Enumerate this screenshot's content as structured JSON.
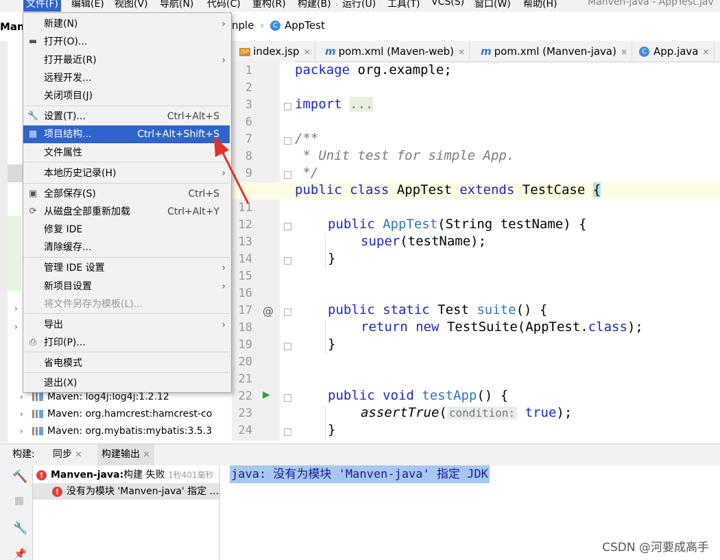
{
  "window": {
    "title": "Manven-java - AppTest.jav",
    "project_name": "Man"
  },
  "menubar": {
    "items": [
      "文件(F)",
      "编辑(E)",
      "视图(V)",
      "导航(N)",
      "代码(C)",
      "重构(R)",
      "构建(B)",
      "运行(U)",
      "工具(T)",
      "VCS(S)",
      "窗口(W)",
      "帮助(H)"
    ]
  },
  "breadcrumb": {
    "prefix": "nple",
    "current": "AppTest"
  },
  "tabs": [
    {
      "label": "index.jsp",
      "icon": "jsp-file-icon"
    },
    {
      "label": "pom.xml (Maven-web)",
      "icon": "maven-icon"
    },
    {
      "label": "pom.xml (Manven-java)",
      "icon": "maven-icon"
    },
    {
      "label": "App.java",
      "icon": "class-icon"
    }
  ],
  "file_menu": {
    "items": [
      {
        "label": "新建(N)",
        "shortcut": "",
        "submenu": true,
        "icon": ""
      },
      {
        "label": "打开(O)...",
        "shortcut": "",
        "submenu": false,
        "icon": "folder-icon"
      },
      {
        "label": "打开最近(R)",
        "shortcut": "",
        "submenu": true,
        "icon": ""
      },
      {
        "label": "远程开发...",
        "shortcut": "",
        "submenu": false,
        "icon": ""
      },
      {
        "label": "关闭项目(J)",
        "shortcut": "",
        "submenu": false,
        "icon": ""
      },
      {
        "label": "设置(T)...",
        "shortcut": "Ctrl+Alt+S",
        "submenu": false,
        "icon": "wrench-icon"
      },
      {
        "label": "项目结构...",
        "shortcut": "Ctrl+Alt+Shift+S",
        "submenu": false,
        "icon": "project-structure-icon"
      },
      {
        "label": "文件属性",
        "shortcut": "",
        "submenu": true,
        "icon": ""
      },
      {
        "label": "本地历史记录(H)",
        "shortcut": "",
        "submenu": true,
        "icon": ""
      },
      {
        "label": "全部保存(S)",
        "shortcut": "Ctrl+S",
        "submenu": false,
        "icon": "save-icon"
      },
      {
        "label": "从磁盘全部重新加载",
        "shortcut": "Ctrl+Alt+Y",
        "submenu": false,
        "icon": "reload-icon"
      },
      {
        "label": "修复 IDE",
        "shortcut": "",
        "submenu": false,
        "icon": ""
      },
      {
        "label": "清除缓存...",
        "shortcut": "",
        "submenu": false,
        "icon": ""
      },
      {
        "label": "管理 IDE 设置",
        "shortcut": "",
        "submenu": true,
        "icon": ""
      },
      {
        "label": "新项目设置",
        "shortcut": "",
        "submenu": true,
        "icon": ""
      },
      {
        "label": "将文件另存为模板(L)...",
        "shortcut": "",
        "submenu": false,
        "icon": ""
      },
      {
        "label": "导出",
        "shortcut": "",
        "submenu": true,
        "icon": ""
      },
      {
        "label": "打印(P)...",
        "shortcut": "",
        "submenu": false,
        "icon": "print-icon"
      },
      {
        "label": "省电模式",
        "shortcut": "",
        "submenu": false,
        "icon": ""
      },
      {
        "label": "退出(X)",
        "shortcut": "",
        "submenu": false,
        "icon": ""
      }
    ],
    "highlighted": "项目结构...",
    "disabled": [
      "将文件另存为模板(L)..."
    ]
  },
  "project_tree": {
    "items": [
      "Maven: log4j:log4j:1.2.12",
      "Maven: org.hamcrest:hamcrest-co",
      "Maven: org.mybatis:mybatis:3.5.3"
    ]
  },
  "editor": {
    "line_numbers": [
      "1",
      "2",
      "3",
      "6",
      "7",
      "8",
      "9",
      "10",
      "11",
      "12",
      "13",
      "14",
      "15",
      "16",
      "17",
      "18",
      "19",
      "20",
      "21",
      "22",
      "23",
      "24"
    ],
    "code": {
      "l1_kw": "package",
      "l1_rest": " org.example;",
      "l3_kw": "import",
      "l3_rest": "...",
      "l7": "/**",
      "l8": " * Unit test for simple App.",
      "l9": " */",
      "l10_kw1": "public class",
      "l10_name": " AppTest ",
      "l10_kw2": "extends",
      "l10_rest": " TestCase ",
      "l10_brace": "{",
      "l12_kw": "public",
      "l12_fn": "AppTest",
      "l12_rest": "(String testName) {",
      "l13_fn": "super",
      "l13_rest": "(testName);",
      "l14": "}",
      "l17_kw": "public static",
      "l17_type": " Test ",
      "l17_fn": "suite",
      "l17_rest": "() {",
      "l18_kw1": "return new",
      "l18_mid": " TestSuite(AppTest.",
      "l18_kw2": "class",
      "l18_end": ");",
      "l19": "}",
      "l22_kw": "public void",
      "l22_fn": "testApp",
      "l22_rest": "() {",
      "l23_call": "assertTrue",
      "l23_open": "(",
      "l23_hint": "condition:",
      "l23_kw": "true",
      "l23_end": ");",
      "l24": "}"
    },
    "gutter_at": "@"
  },
  "build_panel": {
    "tabs": [
      "构建:",
      "同步",
      "构建输出"
    ],
    "active_tab": "构建输出",
    "tree": {
      "root_project": "Manven-java:",
      "root_status": "构建 失败",
      "root_time": "1秒401毫秒",
      "child": "没有为模块 'Manven-java' 指定 ..."
    },
    "output": "java: 没有为模块 'Manven-java' 指定 JDK"
  },
  "watermark": "CSDN @河要成高手",
  "colors": {
    "menu_highlight": "#2f65ca",
    "keyword": "#1d27c2",
    "error": "#d9453d",
    "run_arrow": "#3aa03a"
  }
}
